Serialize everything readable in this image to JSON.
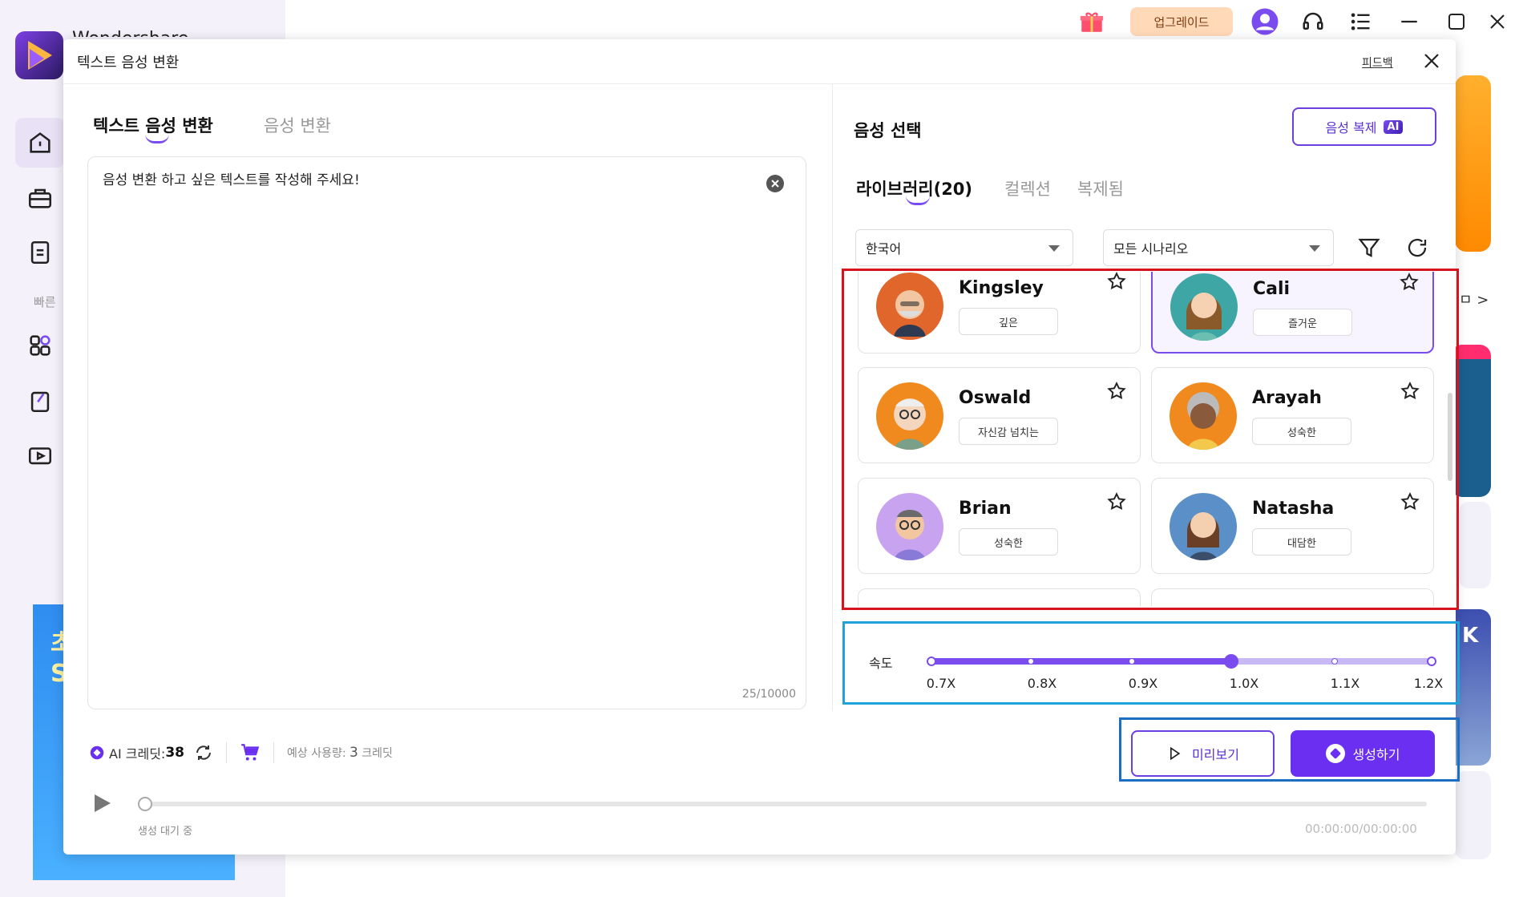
{
  "app": {
    "name": "Wondershare"
  },
  "titlebar": {
    "upgrade_label": "업그레이드"
  },
  "sidebar": {
    "quick_label": "빠른"
  },
  "promo": {
    "text": "초\nS"
  },
  "background": {
    "more_label": "ㅁ >",
    "card_letter": "K"
  },
  "dialog": {
    "title": "텍스트 음성 변환",
    "feedback_label": "피드백"
  },
  "left": {
    "tabs": [
      {
        "label": "텍스트 음성 변환",
        "active": true
      },
      {
        "label": "음성 변환",
        "active": false
      }
    ],
    "text_input": "음성 변환 하고 싶은 텍스트를 작성해 주세요!",
    "char_count": "25/10000",
    "credits_label": "AI 크레딧:",
    "credits_value": "38",
    "estimate_label": "예상 사용량:",
    "estimate_value": "3",
    "estimate_unit": "크레딧"
  },
  "right": {
    "title": "음성 선택",
    "clone_label": "음성 복제",
    "clone_badge": "AI",
    "library_tabs": [
      {
        "label": "라이브러리(20)",
        "active": true
      },
      {
        "label": "컬렉션",
        "active": false
      },
      {
        "label": "복제됨",
        "active": false
      }
    ],
    "language": "한국어",
    "scenario": "모든 시나리오",
    "voices": [
      {
        "name": "Kingsley",
        "tag": "깊은",
        "selected": false,
        "avatar_color": "#e0662c"
      },
      {
        "name": "Cali",
        "tag": "즐거운",
        "selected": true,
        "avatar_color": "#3fa6a6"
      },
      {
        "name": "Oswald",
        "tag": "자신감 넘치는",
        "selected": false,
        "avatar_color": "#f08a1e"
      },
      {
        "name": "Arayah",
        "tag": "성숙한",
        "selected": false,
        "avatar_color": "#f08a1e"
      },
      {
        "name": "Brian",
        "tag": "성숙한",
        "selected": false,
        "avatar_color": "#c8a3ef"
      },
      {
        "name": "Natasha",
        "tag": "대담한",
        "selected": false,
        "avatar_color": "#5a8fc8"
      }
    ],
    "speed_label": "속도",
    "speed_ticks": [
      "0.7X",
      "0.8X",
      "0.9X",
      "1.0X",
      "1.1X",
      "1.2X"
    ],
    "speed_value": "1.0X",
    "preview_label": "미리보기",
    "generate_label": "생성하기"
  },
  "player": {
    "status": "생성 대기 중",
    "time": "00:00:00/00:00:00"
  },
  "colors": {
    "accent": "#6a2ff0",
    "highlight_red": "#d7141e",
    "highlight_blue": "#1ea4dc"
  }
}
